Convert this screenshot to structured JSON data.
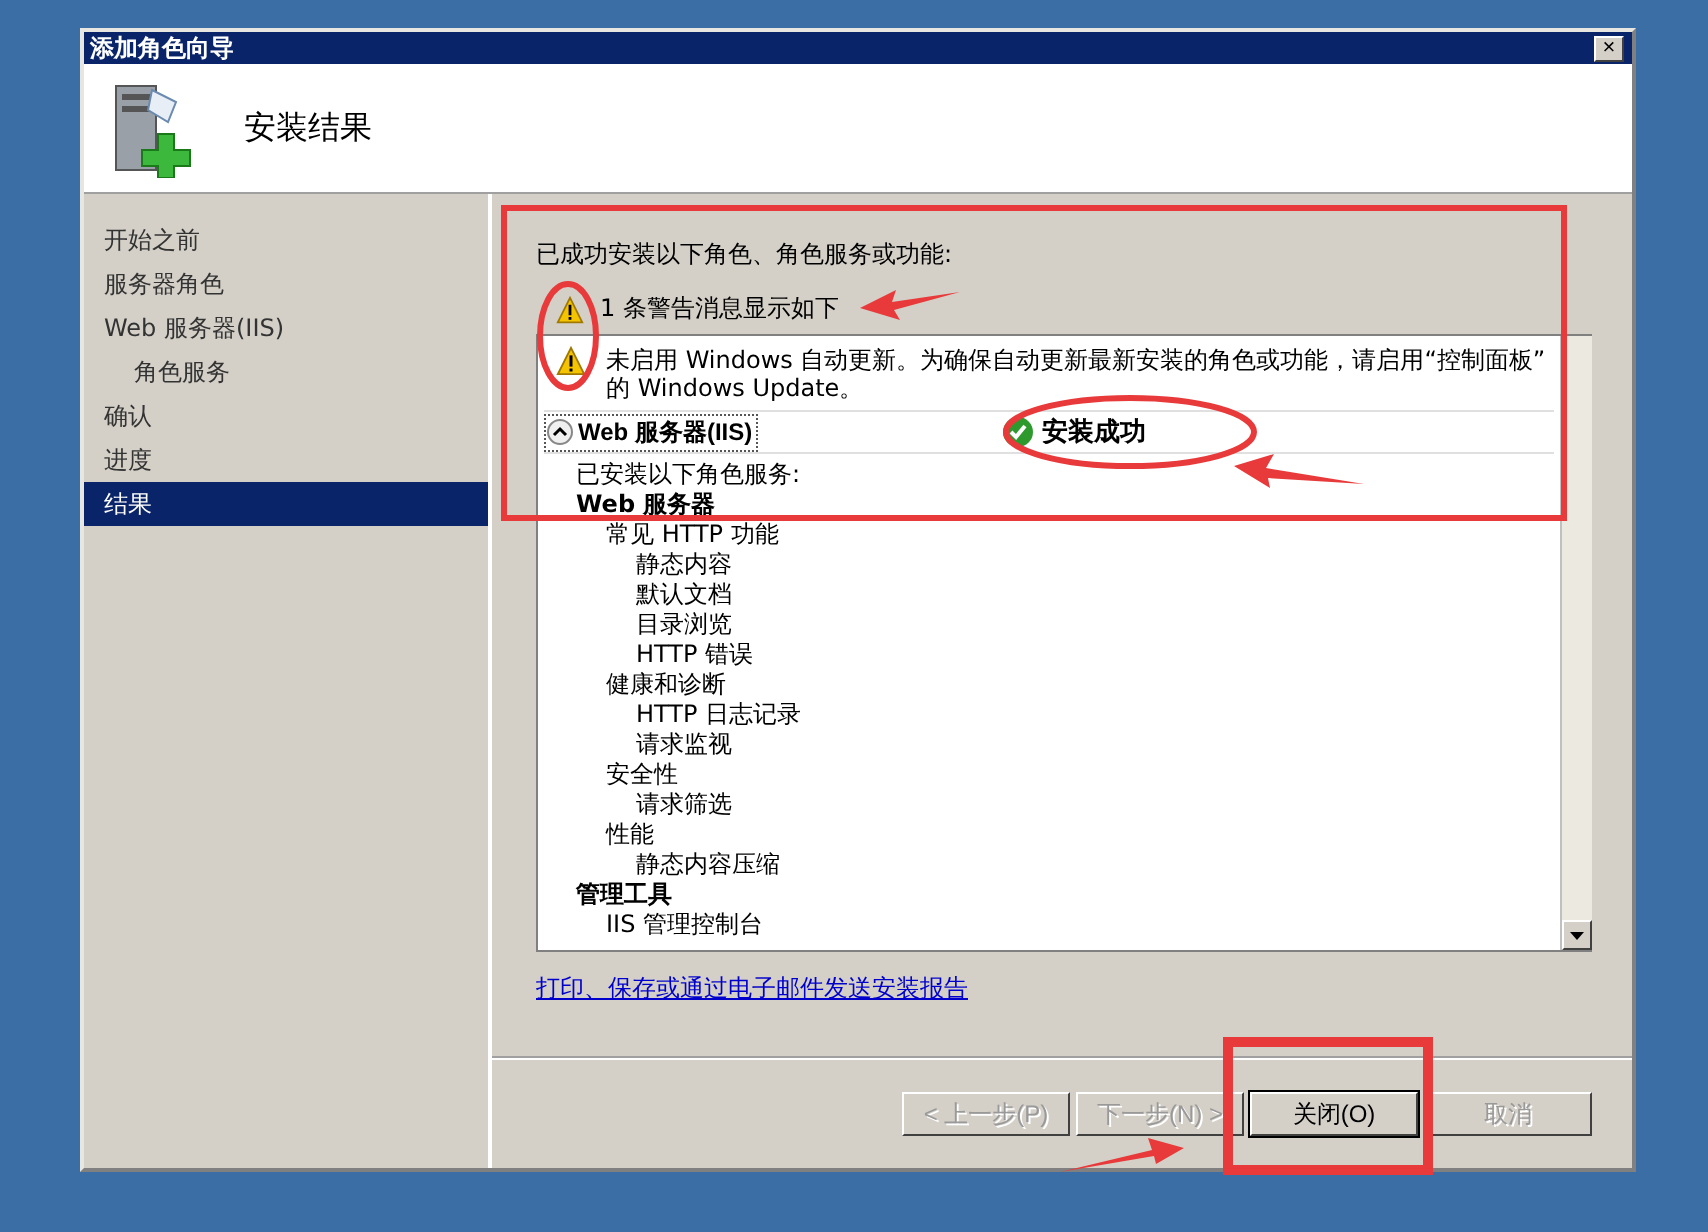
{
  "window": {
    "title": "添加角色向导",
    "close": "×"
  },
  "header": {
    "title": "安装结果"
  },
  "sidebar": {
    "items": [
      {
        "label": "开始之前",
        "selected": false
      },
      {
        "label": "服务器角色",
        "selected": false
      },
      {
        "label": "Web 服务器(IIS)",
        "selected": false,
        "children": [
          {
            "label": "角色服务",
            "selected": false
          }
        ]
      },
      {
        "label": "确认",
        "selected": false
      },
      {
        "label": "进度",
        "selected": false
      },
      {
        "label": "结果",
        "selected": true
      }
    ]
  },
  "summary": "已成功安装以下角色、角色服务或功能:",
  "warning_count": "1 条警告消息显示如下",
  "results": {
    "warning_lines": [
      "未启用 Windows 自动更新。为确保自动更新最新安装的角色或功能，请启用“控制面板”",
      "的 Windows Update。"
    ],
    "section": {
      "title": "Web 服务器(IIS)",
      "expanded": true,
      "status": "安装成功"
    },
    "intro": "已安装以下角色服务:",
    "tree": [
      {
        "label": "Web 服务器",
        "children": [
          {
            "label": "常见 HTTP 功能",
            "children": [
              {
                "label": "静态内容"
              },
              {
                "label": "默认文档"
              },
              {
                "label": "目录浏览"
              },
              {
                "label": "HTTP 错误"
              }
            ]
          },
          {
            "label": "健康和诊断",
            "children": [
              {
                "label": "HTTP 日志记录"
              },
              {
                "label": "请求监视"
              }
            ]
          },
          {
            "label": "安全性",
            "children": [
              {
                "label": "请求筛选"
              }
            ]
          },
          {
            "label": "性能",
            "children": [
              {
                "label": "静态内容压缩"
              }
            ]
          }
        ]
      },
      {
        "label": "管理工具",
        "children": [
          {
            "label": "IIS 管理控制台"
          }
        ]
      }
    ]
  },
  "report_link": "打印、保存或通过电子邮件发送安装报告",
  "buttons": [
    {
      "label": "< 上一步(P)",
      "disabled": true
    },
    {
      "label": "下一步(N) >",
      "disabled": true
    },
    {
      "label": "关闭(O)",
      "disabled": false
    },
    {
      "label": "取消",
      "disabled": true
    }
  ]
}
